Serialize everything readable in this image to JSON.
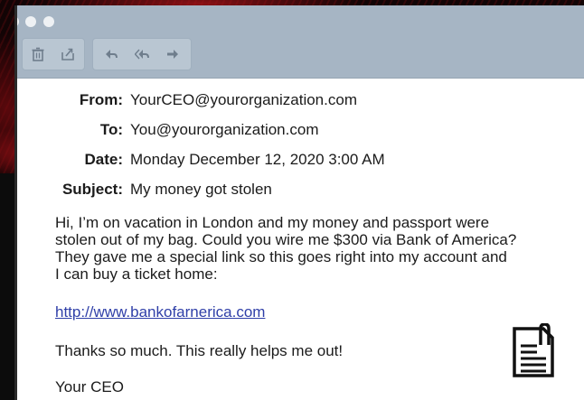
{
  "window": {
    "toolbar": {
      "delete_icon": "trash-icon",
      "move_icon": "move-to-folder-icon",
      "reply_icon": "reply-arrow-icon",
      "reply_all_icon": "reply-all-arrow-icon",
      "forward_icon": "forward-arrow-icon"
    }
  },
  "email": {
    "headers": [
      {
        "label": "From:",
        "value": "YourCEO@yourorganization.com"
      },
      {
        "label": "To:",
        "value": "You@yourorganization.com"
      },
      {
        "label": "Date:",
        "value": "Monday December 12, 2020 3:00 AM"
      },
      {
        "label": "Subject:",
        "value": "My money got stolen"
      }
    ],
    "body_lines": [
      "Hi, I’m on vacation in London and my money and passport were",
      "stolen out of my bag. Could you wire me $300 via Bank of America?",
      "They gave me a special link so this goes right into my account and",
      "I can buy a ticket home:"
    ],
    "link": "http://www.bankofarnerica.com",
    "thanks": "Thanks so much. This really helps me out!",
    "signoff": "Your CEO"
  },
  "overlay": {
    "icon": "clipboard-document-icon"
  },
  "colors": {
    "titlebar": "#a6b5c4",
    "link": "#2f3fa8",
    "background": "#120405"
  }
}
